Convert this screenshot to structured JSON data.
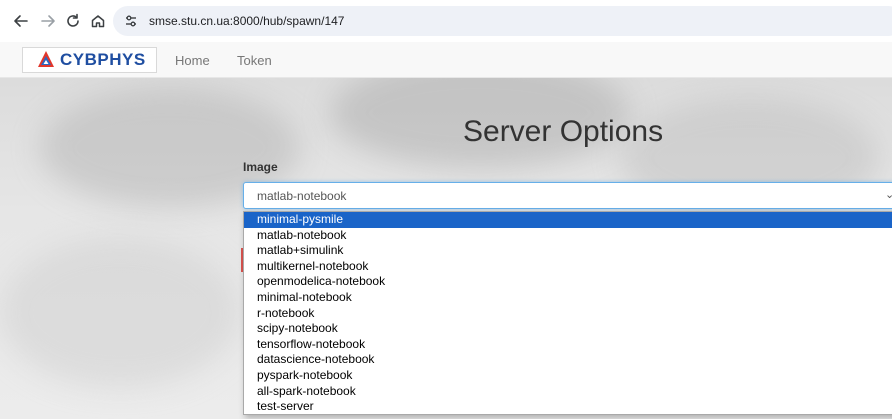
{
  "browser": {
    "url": "smse.stu.cn.ua:8000/hub/spawn/147",
    "icons": {
      "back": "back-arrow-icon",
      "forward": "forward-arrow-icon",
      "reload": "reload-icon",
      "home": "home-icon",
      "site_info": "site-settings-icon"
    }
  },
  "navbar": {
    "logo_text": "CYBPHYS",
    "links": [
      "Home",
      "Token"
    ]
  },
  "main": {
    "title": "Server Options",
    "image_label": "Image",
    "selected_value": "matlab-notebook",
    "options": [
      "minimal-pysmile",
      "matlab-notebook",
      "matlab+simulink",
      "multikernel-notebook",
      "openmodelica-notebook",
      "minimal-notebook",
      "r-notebook",
      "scipy-notebook",
      "tensorflow-notebook",
      "datascience-notebook",
      "pyspark-notebook",
      "all-spark-notebook",
      "test-server"
    ],
    "highlighted_option": "minimal-pysmile"
  },
  "colors": {
    "highlight": "#1a64c8",
    "logo_blue": "#1f4ea1",
    "focus_border": "#66afe9"
  }
}
